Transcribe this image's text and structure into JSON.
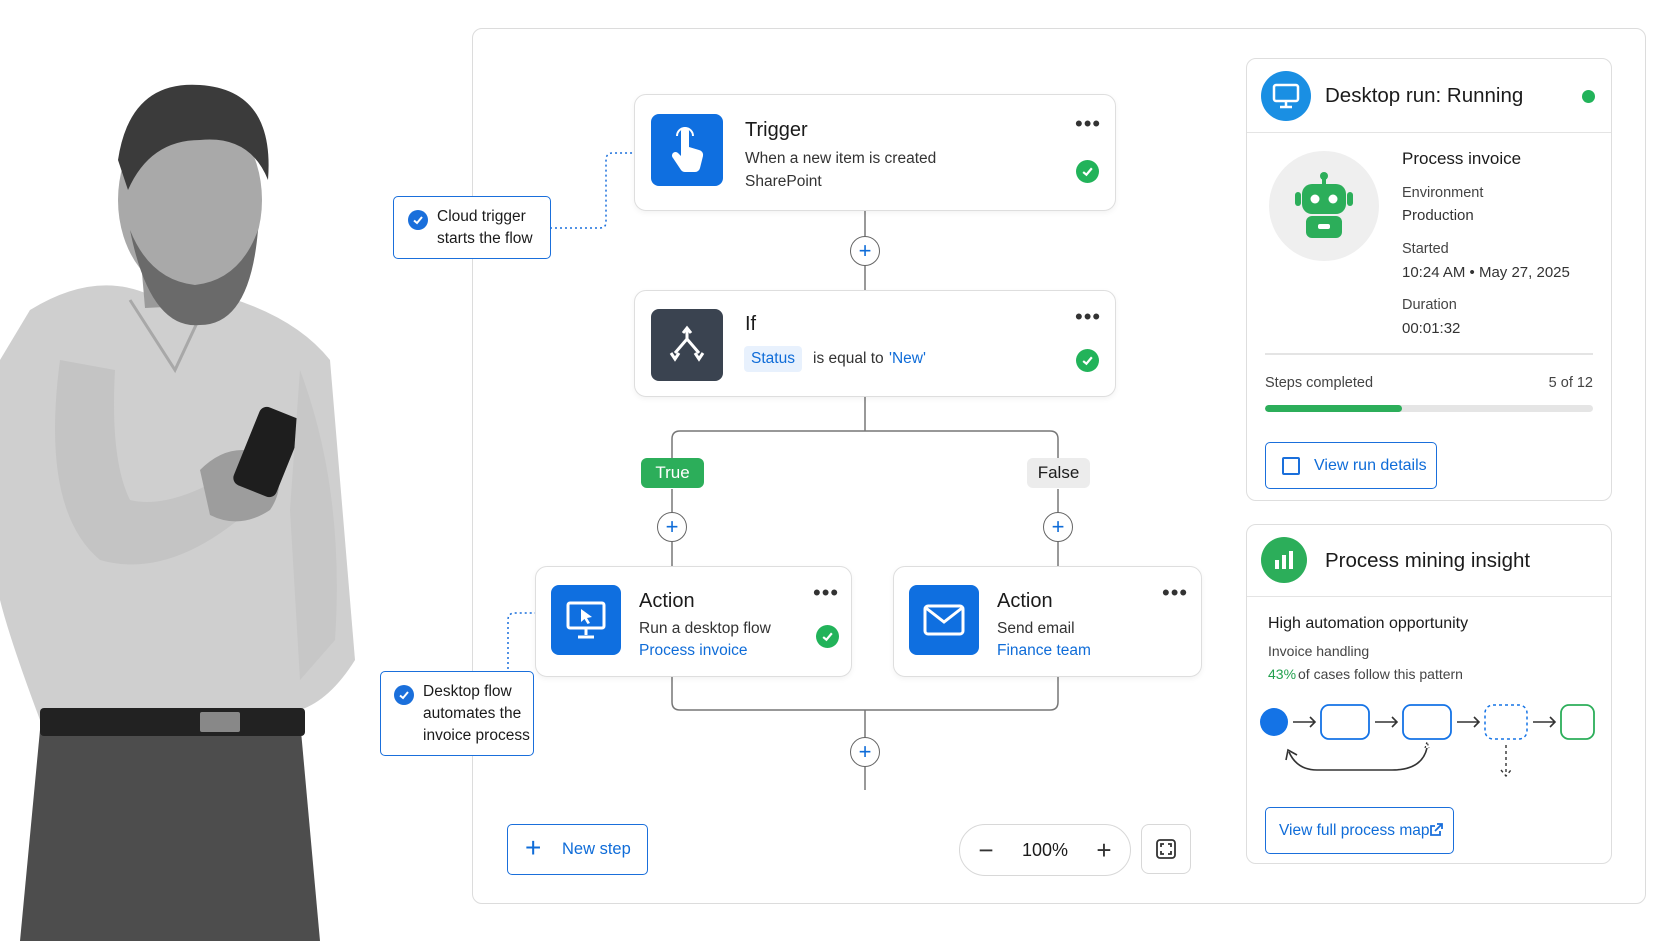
{
  "callouts": {
    "cloud": {
      "line1": "Cloud trigger",
      "line2": "starts the flow"
    },
    "desktop": {
      "line1": "Desktop flow",
      "line2": "automates the",
      "line3": "invoice process"
    }
  },
  "flow": {
    "trigger": {
      "title": "Trigger",
      "line1": "When a new item is created",
      "line2": "SharePoint",
      "icon": "hand-pointer-icon"
    },
    "condition": {
      "title": "If",
      "field": "Status",
      "operator": "is equal to",
      "value": "'New'",
      "icon": "branch-icon"
    },
    "branches": {
      "true_label": "True",
      "false_label": "False"
    },
    "action_desktop": {
      "title": "Action",
      "line1": "Run a desktop flow",
      "link": "Process invoice",
      "icon": "desktop-cursor-icon"
    },
    "action_email": {
      "title": "Action",
      "line1": "Send email",
      "link": "Finance team",
      "icon": "mail-icon"
    },
    "more": "•••"
  },
  "toolbar": {
    "new_step_label": "New step",
    "zoom_level": "100%"
  },
  "desktop_run": {
    "title": "Desktop run: Running",
    "process_name": "Process invoice",
    "environment_label": "Environment",
    "environment_value": "Production",
    "started_label": "Started",
    "started_value": "10:24 AM • May 27, 2025",
    "duration_label": "Duration",
    "duration_value": "00:01:32",
    "steps_label": "Steps completed",
    "steps_value": "5 of 12",
    "steps_done": 5,
    "steps_total": 12,
    "button_label": "View run details"
  },
  "mining": {
    "title": "Process mining insight",
    "headline": "High automation opportunity",
    "subtitle": "Invoice handling",
    "percent": "43%",
    "percent_text": "of cases follow this pattern",
    "button_label": "View full process map"
  },
  "colors": {
    "accent": "#0f6cd8",
    "success": "#2cae5a",
    "dark_tile": "#3a4350"
  }
}
